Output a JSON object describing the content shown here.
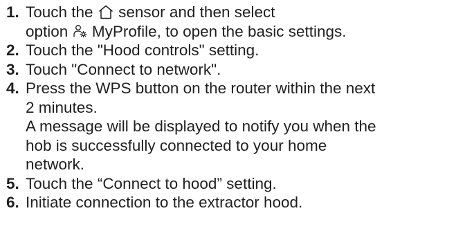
{
  "steps": [
    {
      "num": "1.",
      "lines": {
        "l1_a": "Touch the",
        "l1_b": "sensor and then select",
        "l2_a": "option",
        "l2_b": "MyProfile, to open the basic settings."
      }
    },
    {
      "num": "2.",
      "text": "Touch the \"Hood controls\" setting."
    },
    {
      "num": "3.",
      "text": "Touch \"Connect to network\"."
    },
    {
      "num": "4.",
      "lines": [
        "Press the WPS button on the router within the next",
        "2 minutes.",
        "A message will be displayed to notify you when the",
        "hob is successfully connected to your home",
        "network."
      ]
    },
    {
      "num": "5.",
      "text": "Touch the “Connect to hood” setting."
    },
    {
      "num": "6.",
      "text": "Initiate connection to the extractor hood."
    }
  ],
  "icons": {
    "home": "home-sensor-icon",
    "profile": "myprofile-icon"
  }
}
